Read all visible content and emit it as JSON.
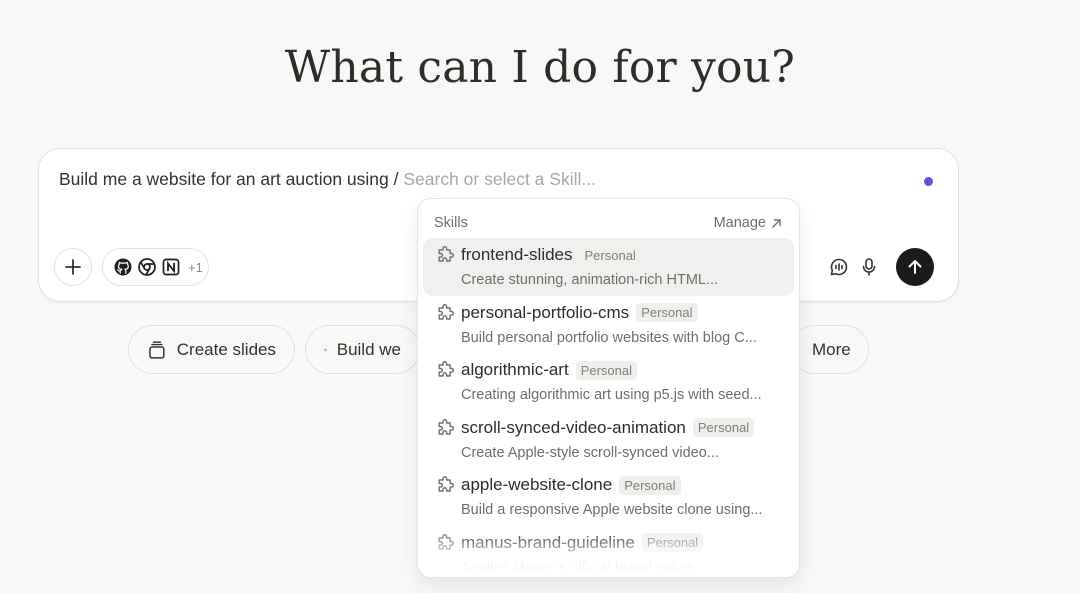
{
  "hero": {
    "title": "What can I do for you?"
  },
  "composer": {
    "input_text": "Build me a website for an art auction using /",
    "slash_placeholder": "Search or select a Skill...",
    "connectors_more": "+1",
    "icons": [
      "plus-icon",
      "github-icon",
      "chrome-icon",
      "notion-icon",
      "voice-chat-icon",
      "microphone-icon",
      "arrow-up-icon"
    ],
    "accent": "#6a4ddf"
  },
  "quick_actions": [
    {
      "label": "Create slides",
      "icon": "slides-icon"
    },
    {
      "label": "Build we",
      "icon": "code-window-icon"
    },
    {
      "label": "More",
      "icon": ""
    }
  ],
  "skills_popup": {
    "title": "Skills",
    "manage_label": "Manage",
    "items": [
      {
        "name": "frontend-slides",
        "badge": "Personal",
        "desc": "Create stunning, animation-rich HTML..."
      },
      {
        "name": "personal-portfolio-cms",
        "badge": "Personal",
        "desc": "Build personal portfolio websites with blog C..."
      },
      {
        "name": "algorithmic-art",
        "badge": "Personal",
        "desc": "Creating algorithmic art using p5.js with seed..."
      },
      {
        "name": "scroll-synced-video-animation",
        "badge": "Personal",
        "desc": "Create Apple-style scroll-synced video..."
      },
      {
        "name": "apple-website-clone",
        "badge": "Personal",
        "desc": "Build a responsive Apple website clone using..."
      },
      {
        "name": "manus-brand-guideline",
        "badge": "Personal",
        "desc": "Applies Manus's official brand colors..."
      }
    ]
  }
}
